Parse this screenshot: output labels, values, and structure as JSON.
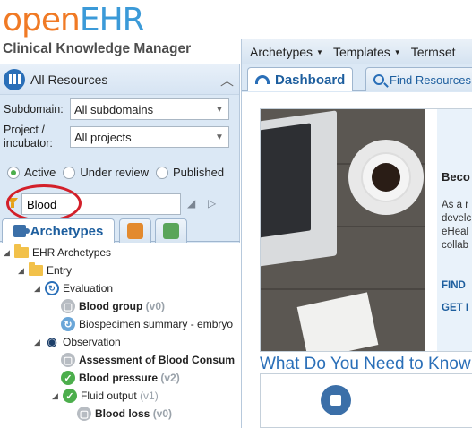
{
  "logo": {
    "part1": "open",
    "part2": "EHR"
  },
  "app_subtitle": "Clinical Knowledge Manager",
  "left_panel": {
    "title": "All Resources",
    "subdomain": {
      "label": "Subdomain:",
      "value": "All subdomains"
    },
    "project": {
      "label_line1": "Project /",
      "label_line2": "incubator:",
      "value": "All projects"
    },
    "status_filter": {
      "options": [
        "Active",
        "Under review",
        "Published"
      ],
      "selected": "Active"
    },
    "search": {
      "value": "Blood"
    },
    "tabs": [
      {
        "label": "Archetypes"
      }
    ],
    "tree": [
      {
        "label": "EHR Archetypes"
      },
      {
        "label": "Entry"
      },
      {
        "label": "Evaluation"
      },
      {
        "label": "Blood group",
        "version": "(v0)"
      },
      {
        "label": "Biospecimen summary - embryo"
      },
      {
        "label": "Observation"
      },
      {
        "label": "Assessment of Blood Consum"
      },
      {
        "label": "Blood pressure",
        "version": "(v2)"
      },
      {
        "label": "Fluid output",
        "version": "(v1)"
      },
      {
        "label": "Blood loss",
        "version": "(v0)"
      }
    ]
  },
  "right_panel": {
    "menu": [
      {
        "label": "Archetypes"
      },
      {
        "label": "Templates"
      },
      {
        "label": "Termset"
      }
    ],
    "tabs": [
      {
        "label": "Dashboard"
      },
      {
        "label": "Find Resources"
      }
    ],
    "hero": {
      "heading": "Beco",
      "text_lines": [
        "As a r",
        "develc",
        "eHeal",
        "collab"
      ],
      "link1": "FIND",
      "link2": "GET I"
    },
    "section_title": "What Do You Need to Know"
  },
  "colors": {
    "brand_orange": "#f07a25",
    "brand_blue": "#3b9ad8",
    "highlight_red": "#d3202a"
  }
}
